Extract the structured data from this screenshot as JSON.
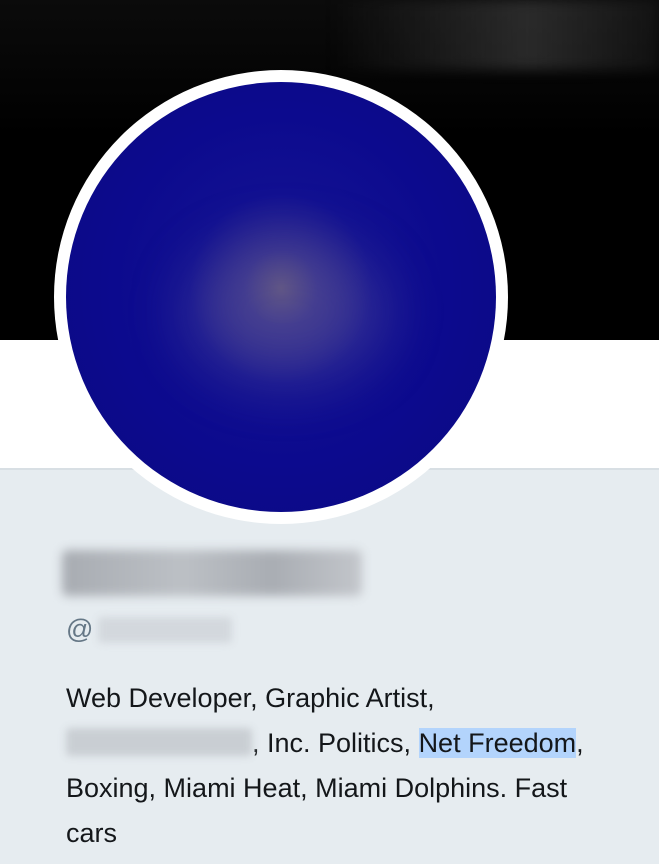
{
  "profile": {
    "handle_prefix": "@",
    "bio": {
      "line1": "Web Developer, Graphic Artist,",
      "line2_after_redaction": ", Inc. Politics, ",
      "line2_highlight": "Net Freedom",
      "line2_end": ",",
      "line3": "Boxing, Miami Heat, Miami Dolphins. Fast",
      "line4": "cars"
    }
  },
  "colors": {
    "avatar_blue": "#0c0a8e",
    "highlight": "#b3d4fc",
    "text": "#14171a",
    "handle_text": "#657786",
    "page_background": "#e6ecf0"
  }
}
